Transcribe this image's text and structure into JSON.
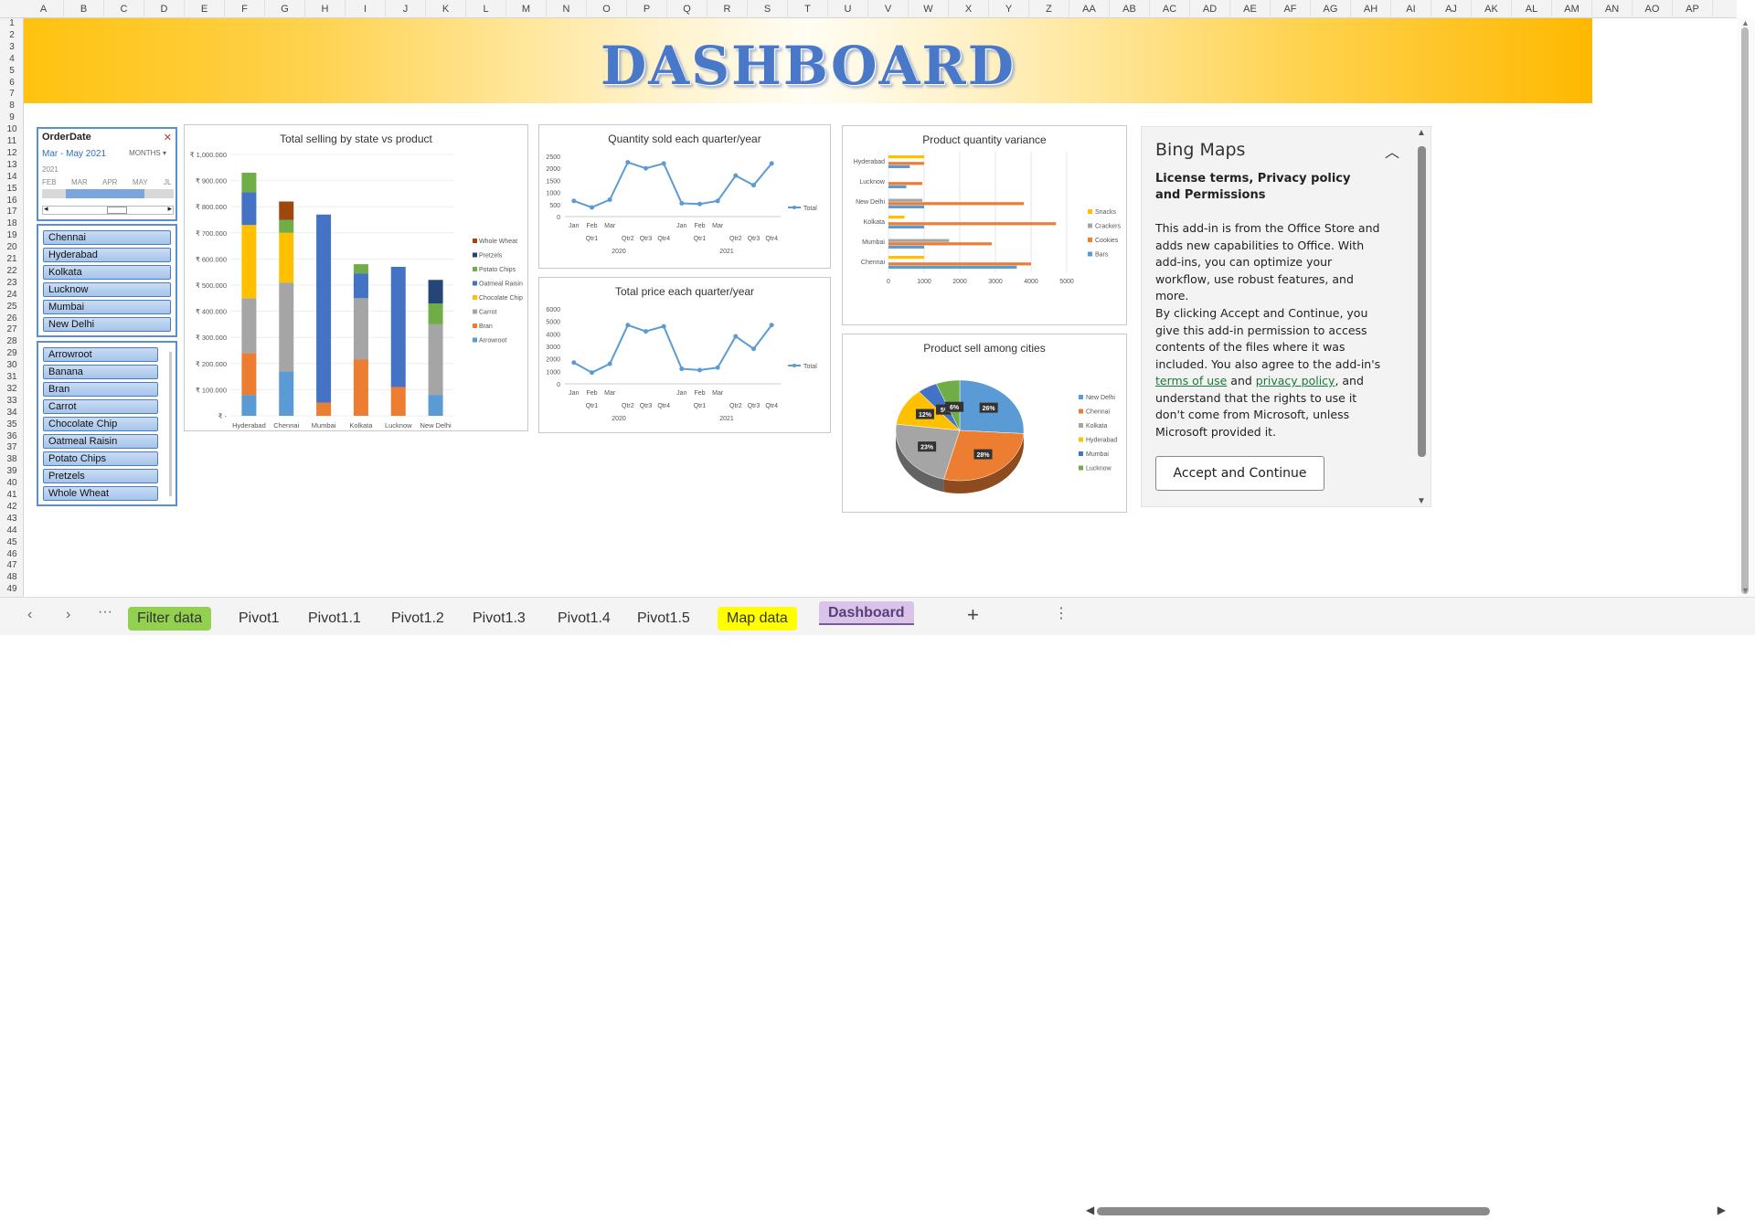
{
  "columns": [
    "A",
    "B",
    "C",
    "D",
    "E",
    "F",
    "G",
    "H",
    "I",
    "J",
    "K",
    "L",
    "M",
    "N",
    "O",
    "P",
    "Q",
    "R",
    "S",
    "T",
    "U",
    "V",
    "W",
    "X",
    "Y",
    "Z",
    "AA",
    "AB",
    "AC",
    "AD",
    "AE",
    "AF",
    "AG",
    "AH",
    "AI",
    "AJ",
    "AK",
    "AL",
    "AM",
    "AN",
    "AO",
    "AP"
  ],
  "rows": [
    "1",
    "2",
    "3",
    "4",
    "5",
    "6",
    "7",
    "8",
    "9",
    "10",
    "11",
    "12",
    "13",
    "14",
    "15",
    "16",
    "17",
    "18",
    "19",
    "20",
    "21",
    "22",
    "23",
    "24",
    "25",
    "26",
    "27",
    "28",
    "29",
    "30",
    "31",
    "32",
    "33",
    "34",
    "35",
    "36",
    "37",
    "38",
    "39",
    "40",
    "41",
    "42",
    "43",
    "44",
    "45",
    "46",
    "47",
    "48",
    "49"
  ],
  "banner": {
    "title": "DASHBOARD"
  },
  "timeline": {
    "title": "OrderDate",
    "range": "Mar - May 2021",
    "unit": "MONTHS",
    "year": "2021",
    "months": [
      "FEB",
      "MAR",
      "APR",
      "MAY",
      "JL"
    ],
    "colors": {
      "selection": "#7aa5dd"
    }
  },
  "city_slicer": {
    "items": [
      "Chennai",
      "Hyderabad",
      "Kolkata",
      "Lucknow",
      "Mumbai",
      "New Delhi"
    ]
  },
  "product_slicer": {
    "items": [
      "Arrowroot",
      "Banana",
      "Bran",
      "Carrot",
      "Chocolate Chip",
      "Oatmeal Raisin",
      "Potato Chips",
      "Pretzels",
      "Whole Wheat"
    ]
  },
  "colors": {
    "blue": "#4472c4",
    "orange": "#ed7d31",
    "gray": "#a5a5a5",
    "yellow": "#ffc000",
    "lightblue": "#5b9bd5",
    "green": "#70ad47",
    "darkblue": "#264478",
    "brown": "#9e480e",
    "navy": "#255e91"
  },
  "chart_data": [
    {
      "id": "stacked",
      "type": "bar",
      "title": "Total selling by state vs product",
      "categories": [
        "Hyderabad",
        "Chennai",
        "Mumbai",
        "Kolkata",
        "Lucknow",
        "New Delhi"
      ],
      "yticks": [
        "₹ -",
        "₹ 100.000",
        "₹ 200.000",
        "₹ 300.000",
        "₹ 400.000",
        "₹ 500.000",
        "₹ 600.000",
        "₹ 700.000",
        "₹ 800.000",
        "₹ 900.000",
        "₹ 1,000.000"
      ],
      "ylim": [
        0,
        1000
      ],
      "series": [
        {
          "name": "Arrowroot",
          "color": "#5b9bd5",
          "values": [
            80,
            170,
            0,
            0,
            0,
            80
          ]
        },
        {
          "name": "Bran",
          "color": "#ed7d31",
          "values": [
            160,
            0,
            50,
            215,
            110,
            0
          ]
        },
        {
          "name": "Carrot",
          "color": "#a5a5a5",
          "values": [
            210,
            340,
            0,
            235,
            0,
            270
          ]
        },
        {
          "name": "Chocolate Chip",
          "color": "#ffc000",
          "values": [
            280,
            190,
            0,
            0,
            0,
            0
          ]
        },
        {
          "name": "Oatmeal Raisin",
          "color": "#4472c4",
          "values": [
            125,
            0,
            720,
            95,
            460,
            0
          ]
        },
        {
          "name": "Potato Chips",
          "color": "#70ad47",
          "values": [
            75,
            50,
            0,
            35,
            0,
            80
          ]
        },
        {
          "name": "Pretzels",
          "color": "#264478",
          "values": [
            0,
            0,
            0,
            0,
            0,
            90
          ]
        },
        {
          "name": "Whole Wheat",
          "color": "#9e480e",
          "values": [
            0,
            70,
            0,
            0,
            0,
            0
          ]
        }
      ]
    },
    {
      "id": "qty",
      "type": "line",
      "title": "Quantity sold each quarter/year",
      "months": [
        "Jan",
        "Feb",
        "Mar",
        "",
        "",
        "",
        "Jan",
        "Feb",
        "Mar",
        "",
        "",
        ""
      ],
      "quarters": [
        "Qtr1",
        "Qtr2",
        "Qtr3",
        "Qtr4",
        "Qtr1",
        "Qtr2",
        "Qtr3",
        "Qtr4"
      ],
      "years": [
        "2020",
        "2021"
      ],
      "yticks": [
        "0",
        "500",
        "1000",
        "1500",
        "2000",
        "2500"
      ],
      "ylim": [
        0,
        2500
      ],
      "series": [
        {
          "name": "Total",
          "values": [
            650,
            380,
            700,
            2250,
            2000,
            2200,
            550,
            520,
            650,
            1700,
            1300,
            2200
          ]
        }
      ]
    },
    {
      "id": "price",
      "type": "line",
      "title": "Total price each quarter/year",
      "months": [
        "Jan",
        "Feb",
        "Mar",
        "",
        "",
        "",
        "Jan",
        "Feb",
        "Mar",
        "",
        "",
        ""
      ],
      "quarters": [
        "Qtr1",
        "Qtr2",
        "Qtr3",
        "Qtr4",
        "Qtr1",
        "Qtr2",
        "Qtr3",
        "Qtr4"
      ],
      "years": [
        "2020",
        "2021"
      ],
      "yticks": [
        "0",
        "1000",
        "2000",
        "3000",
        "4000",
        "5000",
        "6000"
      ],
      "ylim": [
        0,
        6000
      ],
      "series": [
        {
          "name": "Total",
          "values": [
            1700,
            900,
            1600,
            4700,
            4200,
            4600,
            1200,
            1100,
            1300,
            3800,
            2800,
            4700
          ]
        }
      ]
    },
    {
      "id": "variance",
      "type": "bar",
      "title": "Product quantity variance",
      "categories": [
        "Hyderabad",
        "Lucknow",
        "New Delhi",
        "Kolkata",
        "Mumbai",
        "Chennai"
      ],
      "xticks": [
        "0",
        "1000",
        "2000",
        "3000",
        "4000",
        "5000"
      ],
      "xlim": [
        0,
        5000
      ],
      "series": [
        {
          "name": "Snacks",
          "color": "#ffc000",
          "values": [
            1000,
            0,
            0,
            450,
            0,
            1000
          ]
        },
        {
          "name": "Crackers",
          "color": "#a5a5a5",
          "values": [
            0,
            0,
            950,
            0,
            1700,
            0
          ]
        },
        {
          "name": "Cookies",
          "color": "#ed7d31",
          "values": [
            1000,
            950,
            3800,
            4700,
            2900,
            4000
          ]
        },
        {
          "name": "Bars",
          "color": "#5b9bd5",
          "values": [
            600,
            500,
            1000,
            1000,
            1000,
            3600
          ]
        }
      ]
    },
    {
      "id": "pie",
      "type": "pie",
      "title": "Product sell among cities",
      "series": [
        {
          "name": "New Delhi",
          "color": "#5b9bd5",
          "value": 26,
          "label": "26%"
        },
        {
          "name": "Chennai",
          "color": "#ed7d31",
          "value": 28,
          "label": "28%"
        },
        {
          "name": "Kolkata",
          "color": "#a5a5a5",
          "value": 23,
          "label": "23%"
        },
        {
          "name": "Hyderabad",
          "color": "#ffc000",
          "value": 12,
          "label": "12%"
        },
        {
          "name": "Mumbai",
          "color": "#4472c4",
          "value": 5,
          "label": "5%"
        },
        {
          "name": "Lucknow",
          "color": "#70ad47",
          "value": 6,
          "label": "6%"
        }
      ]
    }
  ],
  "bing": {
    "title": "Bing Maps",
    "heading": "License terms, Privacy policy and Permissions",
    "p1": "This add-in is from the Office Store and adds new capabilities to Office. With add-ins, you can optimize your workflow, use robust features, and more.",
    "p2a": "By clicking Accept and Continue, you give this add-in permission to access contents of the files where it was included. You also agree to the add-in's ",
    "link1": "terms of use",
    "p2b": " and ",
    "link2": "privacy policy",
    "p2c": ", and understand that the rights to use it don't come from Microsoft, unless Microsoft provided it.",
    "button": "Accept and Continue"
  },
  "tabs": {
    "items": [
      {
        "label": "Filter data",
        "bg": "#92d050"
      },
      {
        "label": "Pivot1",
        "bg": ""
      },
      {
        "label": "Pivot1.1",
        "bg": ""
      },
      {
        "label": "Pivot1.2",
        "bg": ""
      },
      {
        "label": "Pivot1.3",
        "bg": ""
      },
      {
        "label": "Pivot1.4",
        "bg": ""
      },
      {
        "label": "Pivot1.5",
        "bg": ""
      },
      {
        "label": "Map data",
        "bg": "#ffff00"
      },
      {
        "label": "Dashboard",
        "bg": "#d9c3e9"
      }
    ],
    "active": "Dashboard"
  }
}
